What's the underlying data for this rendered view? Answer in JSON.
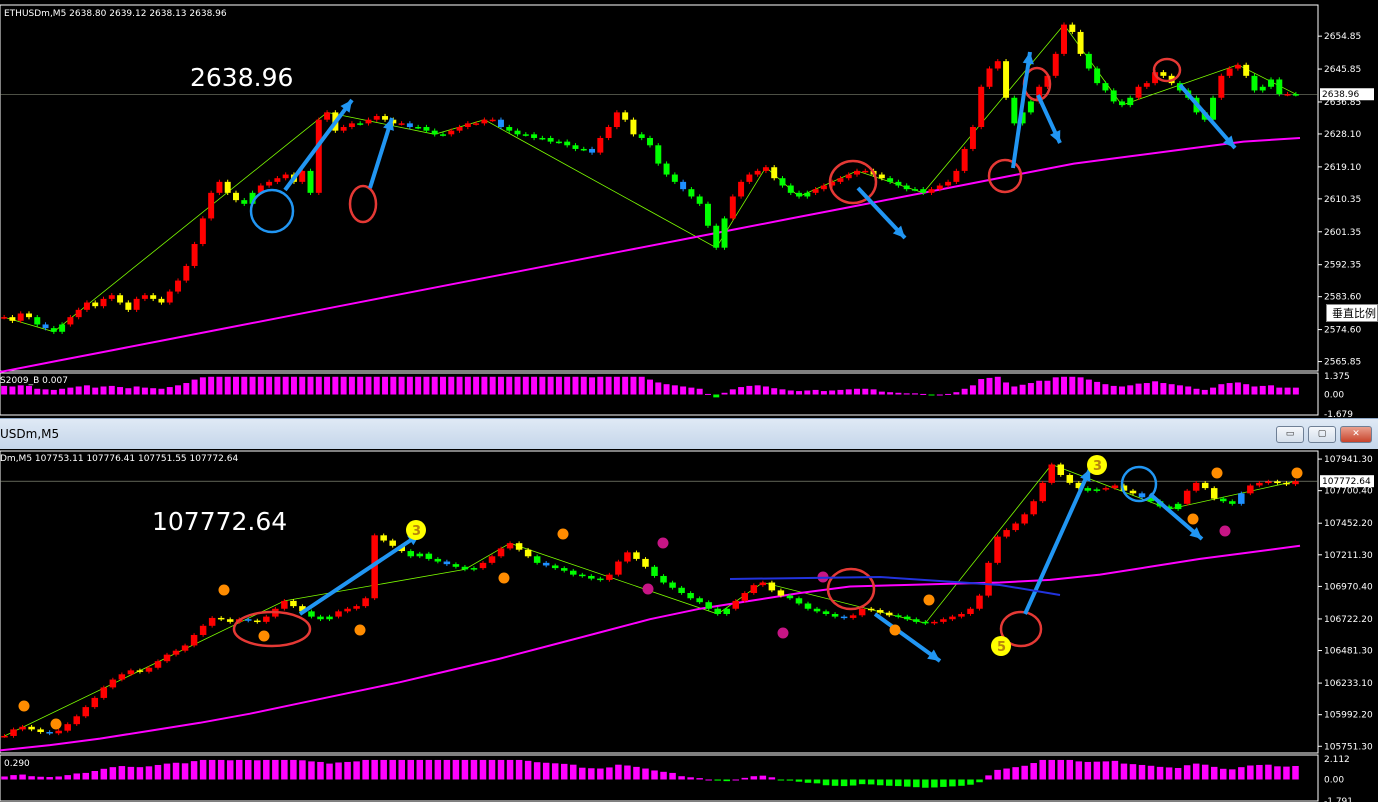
{
  "charts": [
    {
      "symbol_header": "ETHUSDm,M5  2638.80 2639.12 2638.13 2638.96",
      "big_price": "2638.96",
      "current_price_label": "2638.96",
      "axis_ticks": [
        "2654.85",
        "2645.85",
        "2636.85",
        "2628.10",
        "2619.10",
        "2610.35",
        "2601.35",
        "2592.35",
        "2583.60",
        "2574.60",
        "2565.85"
      ],
      "indicator_label": "S2009_B 0.007",
      "indicator_ticks": [
        "1.375",
        "0.00",
        "-1.679"
      ],
      "tooltip": "垂直比例"
    },
    {
      "window_title": "USDm,M5",
      "symbol_header": "Dm,M5  107753.11 107776.41 107751.55 107772.64",
      "big_price": "107772.64",
      "current_price_label": "107772.64",
      "axis_ticks": [
        "107941.30",
        "107700.40",
        "107452.20",
        "107211.30",
        "106970.40",
        "106722.20",
        "106481.30",
        "106233.10",
        "105992.20",
        "105751.30"
      ],
      "indicator_label": "0.290",
      "indicator_ticks": [
        "2.112",
        "0.00",
        "-1.791"
      ],
      "wave_labels": [
        "3",
        "5",
        "3"
      ],
      "window_buttons": [
        "▭",
        "▢",
        "✕"
      ]
    }
  ],
  "chart_data": [
    {
      "type": "candlestick",
      "title": "ETHUSDm,M5",
      "ylim": [
        2563,
        2662
      ],
      "ma_color": "#ff00ff",
      "candle_colors": [
        "#ff0000",
        "#ffff00",
        "#00ff00",
        "#1e90ff"
      ],
      "closes": [
        2578,
        2577,
        2579,
        2578,
        2576,
        2575,
        2574,
        2576,
        2578,
        2580,
        2582,
        2581,
        2583,
        2584,
        2582,
        2580,
        2583,
        2584,
        2583,
        2582,
        2585,
        2588,
        2592,
        2598,
        2605,
        2612,
        2615,
        2612,
        2610,
        2609,
        2612,
        2614,
        2615,
        2616,
        2617,
        2615,
        2618,
        2612,
        2632,
        2634,
        2629,
        2630,
        2631,
        2631,
        2632,
        2633,
        2632,
        2631,
        2631,
        2630,
        2630,
        2629,
        2628,
        2628,
        2629,
        2630,
        2631,
        2631,
        2632,
        2632,
        2630,
        2629,
        2628,
        2628,
        2627,
        2627,
        2626,
        2626,
        2625,
        2624,
        2624,
        2623,
        2627,
        2630,
        2634,
        2632,
        2628,
        2627,
        2625,
        2620,
        2617,
        2615,
        2613,
        2611,
        2609,
        2603,
        2597,
        2605,
        2611,
        2615,
        2617,
        2618,
        2619,
        2616,
        2614,
        2612,
        2611,
        2612,
        2613,
        2614,
        2615,
        2616,
        2617,
        2618,
        2618,
        2617,
        2616,
        2615,
        2614,
        2613,
        2613,
        2612,
        2613,
        2614,
        2615,
        2618,
        2624,
        2630,
        2641,
        2646,
        2648,
        2638,
        2631,
        2634,
        2637,
        2641,
        2644,
        2650,
        2658,
        2656,
        2650,
        2646,
        2642,
        2640,
        2637,
        2636,
        2638,
        2641,
        2642,
        2645,
        2644,
        2642,
        2640,
        2638,
        2634,
        2632,
        2638,
        2644,
        2646,
        2647,
        2644,
        2640,
        2641,
        2643,
        2639,
        2639,
        2638.96
      ],
      "ma": [
        2563,
        2566,
        2569,
        2572,
        2575,
        2578,
        2581,
        2584,
        2587,
        2590,
        2593,
        2596,
        2599,
        2602,
        2605,
        2608,
        2611,
        2614,
        2617,
        2620,
        2622,
        2624,
        2626,
        2627
      ]
    },
    {
      "type": "candlestick",
      "title": "USDm,M5",
      "ylim": [
        105700,
        107980
      ],
      "ma_color": "#ff00ff",
      "candle_colors": [
        "#ff0000",
        "#ffff00",
        "#00ff00",
        "#1e90ff"
      ],
      "closes": [
        105830,
        105880,
        105900,
        105880,
        105860,
        105850,
        105870,
        105920,
        105980,
        106050,
        106120,
        106200,
        106260,
        106300,
        106330,
        106320,
        106350,
        106400,
        106450,
        106480,
        106520,
        106600,
        106670,
        106730,
        106720,
        106700,
        106720,
        106710,
        106700,
        106740,
        106800,
        106860,
        106820,
        106780,
        106740,
        106720,
        106740,
        106780,
        106800,
        106820,
        106880,
        107360,
        107320,
        107280,
        107240,
        107200,
        107220,
        107180,
        107160,
        107140,
        107120,
        107100,
        107110,
        107150,
        107200,
        107260,
        107300,
        107250,
        107200,
        107150,
        107130,
        107110,
        107090,
        107060,
        107050,
        107030,
        107020,
        107060,
        107160,
        107230,
        107180,
        107120,
        107050,
        107000,
        106960,
        106920,
        106880,
        106850,
        106800,
        106760,
        106800,
        106860,
        106920,
        106980,
        107000,
        106940,
        106900,
        106880,
        106840,
        106800,
        106780,
        106760,
        106740,
        106730,
        106750,
        106800,
        106790,
        106770,
        106750,
        106740,
        106720,
        106700,
        106690,
        106700,
        106720,
        106740,
        106760,
        106800,
        106900,
        107150,
        107350,
        107400,
        107450,
        107520,
        107620,
        107760,
        107900,
        107820,
        107760,
        107720,
        107700,
        107710,
        107720,
        107740,
        107700,
        107680,
        107650,
        107620,
        107580,
        107560,
        107600,
        107700,
        107760,
        107720,
        107640,
        107620,
        107600,
        107680,
        107740,
        107760,
        107770,
        107760,
        107750,
        107772.64
      ],
      "ma": [
        105720,
        105760,
        105810,
        105870,
        105930,
        106000,
        106080,
        106160,
        106240,
        106330,
        106420,
        106520,
        106620,
        106720,
        106800,
        106860,
        106920,
        106970,
        106980,
        106990,
        107000,
        107020,
        107060,
        107120,
        107180,
        107230,
        107280
      ]
    }
  ]
}
